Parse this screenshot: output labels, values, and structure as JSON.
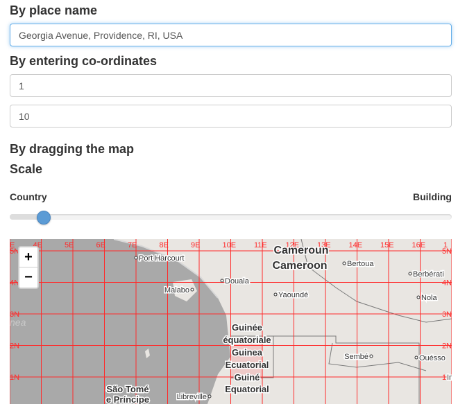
{
  "place": {
    "heading": "By place name",
    "input_value": "Georgia Avenue, Providence, RI, USA"
  },
  "coords": {
    "heading": "By entering co-ordinates",
    "first_value": "1",
    "second_value": "10"
  },
  "drag": {
    "heading": "By dragging the map"
  },
  "scale": {
    "heading": "Scale",
    "min_label": "Country",
    "max_label": "Building",
    "value_fraction": 0.077
  },
  "map": {
    "zoom_in": "+",
    "zoom_out": "−",
    "lon_labels": [
      "E",
      "4E",
      "5E",
      "6E",
      "7E",
      "8E",
      "9E",
      "10E",
      "11E",
      "12E",
      "13E",
      "14E",
      "15E",
      "16E",
      "1"
    ],
    "lat_labels": [
      "5N",
      "4N",
      "3N",
      "2N",
      "1N"
    ],
    "places": [
      "Port Harcourt",
      "Malabo",
      "Douala",
      "Yaoundé",
      "Bertoua",
      "Berbérati",
      "Nola",
      "Sembé",
      "Ouésso",
      "Libreville",
      "Im"
    ],
    "countries": [
      "Cameroun",
      "Cameroon",
      "Guinée",
      "équatoriale",
      "Guinea",
      "Ecuatorial",
      "Guiné",
      "Equatorial",
      "São Tomé",
      "e Príncipe"
    ],
    "sea_label": "nea",
    "colors": {
      "land": "#e9e6e2",
      "sea": "#a9a9a9",
      "grid": "#ff2a2a",
      "highlight": "#f2b2b2"
    }
  }
}
